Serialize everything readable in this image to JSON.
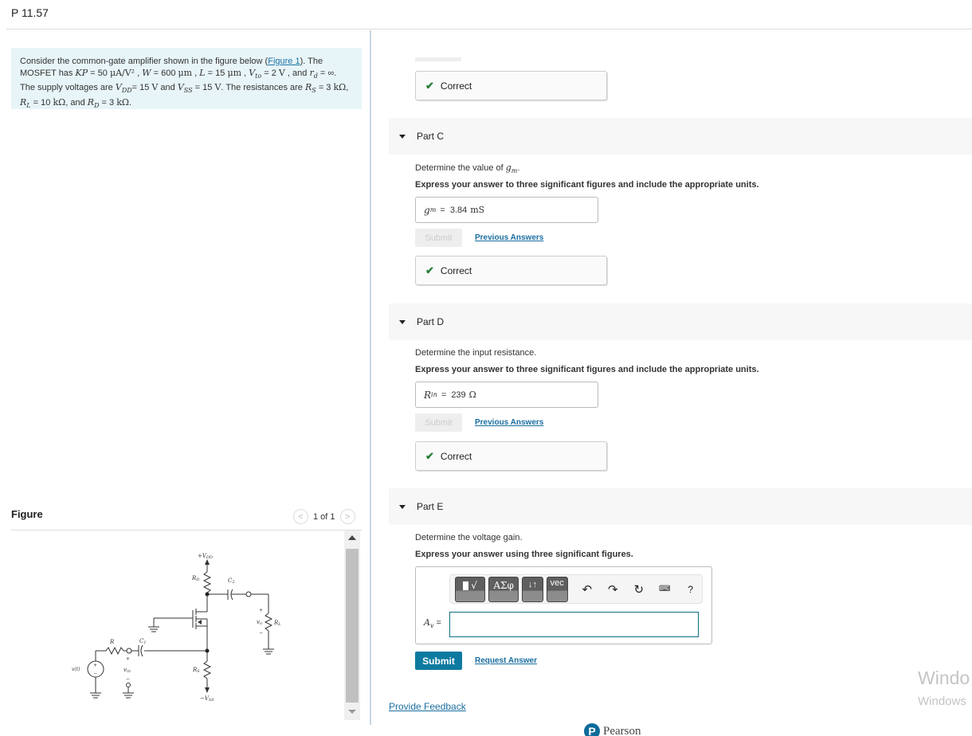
{
  "page": {
    "title": "P 11.57"
  },
  "problem": {
    "intro": "Consider the common-gate amplifier shown in the figure below (",
    "figure_link": "Figure 1",
    "intro_end": "). The MOSFET has ",
    "kp": "KP",
    "kp_val": " = 50 ",
    "kp_unit": "μA/V²",
    "w": "W",
    "w_val": " = 600 ",
    "w_unit": "μm",
    "l": "L",
    "l_val": " = 15 ",
    "l_unit": "μm",
    "vto": "V",
    "vto_sub": "to",
    "vto_val": " = 2 ",
    "vto_unit": "V",
    "rd": "r",
    "rd_sub": "d",
    "rd_val": " = ∞. The supply voltages are ",
    "vdd": "V",
    "vdd_sub": "DD",
    "vdd_val": "= 15 ",
    "vdd_unit": "V",
    "and": " and ",
    "vss": "V",
    "vss_sub": "SS",
    "vss_val": " = 15 ",
    "vss_unit": "V",
    "res_text": ". The resistances are ",
    "rs": "R",
    "rs_sub": "S",
    "rs_val": " = 3 ",
    "kohm": "kΩ",
    "rl": "R",
    "rl_sub": "L",
    "rl_val": " = 10 ",
    "and2": ", and ",
    "rdd": "R",
    "rdd_sub": "D",
    "rdd_val": " = 3 ",
    "end": "."
  },
  "figure": {
    "title": "Figure",
    "counter": "1 of 1",
    "prev_icon": "chevron-left-icon",
    "next_icon": "chevron-right-icon",
    "labels": {
      "vdd": "+V",
      "vdd_sub": "DD",
      "rd": "R",
      "rd_sub": "D",
      "c2": "C",
      "c2_sub": "2",
      "vo": "v",
      "vo_sub": "o",
      "rl": "R",
      "rl_sub": "L",
      "r": "R",
      "c1": "C",
      "c1_sub": "1",
      "source": "v(t)",
      "vin": "v",
      "vin_sub": "in",
      "rs": "R",
      "rs_sub": "S",
      "vss": "−V",
      "vss_sub": "SS",
      "plus": "+",
      "minus": "−"
    }
  },
  "parts": {
    "prev": {
      "status": "Correct"
    },
    "c": {
      "label": "Part C",
      "question": "Determine the value of ",
      "question_var": "g",
      "question_sub": "m",
      "instruction": "Express your answer to three significant figures and include the appropriate units.",
      "answer_var": "g",
      "answer_sub": "m",
      "answer_eq": " = ",
      "answer_value": "3.84",
      "answer_unit": "mS",
      "submit": "Submit",
      "previous_answers": "Previous Answers",
      "status": "Correct"
    },
    "d": {
      "label": "Part D",
      "question": "Determine the input resistance.",
      "instruction": "Express your answer to three significant figures and include the appropriate units.",
      "answer_var": "R",
      "answer_sub": "in",
      "answer_eq": " = ",
      "answer_value": "239",
      "answer_unit": "Ω",
      "submit": "Submit",
      "previous_answers": "Previous Answers",
      "status": "Correct"
    },
    "e": {
      "label": "Part E",
      "question": "Determine the voltage gain.",
      "instruction": "Express your answer using three significant figures.",
      "toolbar": {
        "templates": "√",
        "greek": "ΑΣφ",
        "arrows": "↓↑",
        "vec": "vec",
        "undo_icon": "↶",
        "redo_icon": "↷",
        "reset_icon": "↻",
        "keyboard_icon": "⌨",
        "help": "?"
      },
      "answer_var": "A",
      "answer_sub": "v",
      "answer_eq": " =",
      "answer_value": "",
      "submit": "Submit",
      "request_answer": "Request Answer"
    }
  },
  "footer": {
    "feedback": "Provide Feedback",
    "brand": "Pearson",
    "brand_logo": "P"
  },
  "watermark": {
    "line1": "Windo",
    "line2": "Windows"
  },
  "colors": {
    "accent": "#0d7aa0",
    "link": "#1a6ea0",
    "correct": "#2a7e3a",
    "problem_bg": "#e8f5f8",
    "input_border_active": "#0e6f83"
  }
}
